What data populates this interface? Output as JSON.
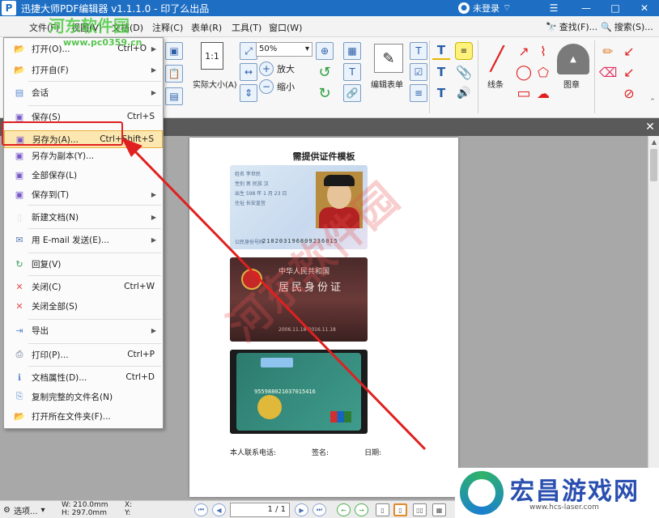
{
  "window": {
    "title": "迅捷大师PDF编辑器 v1.1.1.0 - 印了么出品",
    "user_label": "未登录",
    "app_logo_letter": "P"
  },
  "watermark_site": {
    "name": "河东软件园",
    "url": "www.pc0359.cn"
  },
  "menubar": {
    "items": [
      "文件(F)",
      "视图(V)",
      "文档(D)",
      "注释(C)",
      "表单(R)",
      "工具(T)",
      "窗口(W)"
    ],
    "find_label": "查找(F)...",
    "search_label": "搜索(S)..."
  },
  "toolbar": {
    "zoom_value": "50%",
    "actual_size_label": "实际大小(A)",
    "zoom_in_label": "放大",
    "zoom_out_label": "缩小",
    "edit_form_label": "编辑表单",
    "line_label": "线条",
    "stamp_label": "图章"
  },
  "file_menu": {
    "items": [
      {
        "label": "打开(O)...",
        "shortcut": "Ctrl+O",
        "icon": "folder-open-icon",
        "submenu": true
      },
      {
        "label": "打开自(F)",
        "shortcut": "",
        "icon": "folder-from-icon",
        "submenu": true
      },
      {
        "label": "会话",
        "shortcut": "",
        "icon": "session-icon",
        "submenu": true
      },
      {
        "label": "保存(S)",
        "shortcut": "Ctrl+S",
        "icon": "save-icon",
        "submenu": false
      },
      {
        "label": "另存为(A)...",
        "shortcut": "Ctrl+Shift+S",
        "icon": "save-as-icon",
        "submenu": false
      },
      {
        "label": "另存为副本(Y)...",
        "shortcut": "",
        "icon": "save-copy-icon",
        "submenu": false
      },
      {
        "label": "全部保存(L)",
        "shortcut": "",
        "icon": "save-all-icon",
        "submenu": false
      },
      {
        "label": "保存到(T)",
        "shortcut": "",
        "icon": "save-to-icon",
        "submenu": true
      },
      {
        "label": "新建文档(N)",
        "shortcut": "",
        "icon": "new-document-icon",
        "submenu": true
      },
      {
        "label": "用 E-mail 发送(E)...",
        "shortcut": "",
        "icon": "email-icon",
        "submenu": true
      },
      {
        "label": "回复(V)",
        "shortcut": "",
        "icon": "revert-icon",
        "submenu": false
      },
      {
        "label": "关闭(C)",
        "shortcut": "Ctrl+W",
        "icon": "close-document-icon",
        "submenu": false
      },
      {
        "label": "关闭全部(S)",
        "shortcut": "",
        "icon": "close-all-icon",
        "submenu": false
      },
      {
        "label": "导出",
        "shortcut": "",
        "icon": "export-icon",
        "submenu": true
      },
      {
        "label": "打印(P)...",
        "shortcut": "Ctrl+P",
        "icon": "print-icon",
        "submenu": false
      },
      {
        "label": "文档属性(D)...",
        "shortcut": "Ctrl+D",
        "icon": "document-properties-icon",
        "submenu": false
      },
      {
        "label": "复制完整的文件名(N)",
        "shortcut": "",
        "icon": "copy-filename-icon",
        "submenu": false
      },
      {
        "label": "打开所在文件夹(F)...",
        "shortcut": "",
        "icon": "open-folder-icon",
        "submenu": false
      }
    ]
  },
  "document": {
    "title": "需提供证件模板",
    "id_front_fields": [
      "姓名 李世民",
      "性别 男  民族 汉",
      "出生 598 年 1 月 23 日",
      "住址 长安皇宫"
    ],
    "id_front_number_label": "公民身份号码",
    "id_front_number": "210203196809236015",
    "id_back_country": "中华人民共和国",
    "id_back_title": "居民身份证",
    "id_back_validity": "2006.11.18-2016.11.18",
    "bank_card_number": "955988021037015416",
    "footer": [
      "本人联系电话:",
      "签名:",
      "日期:"
    ],
    "watermark": "河东软件园"
  },
  "statusbar": {
    "options_label": "选项...",
    "width_label": "W: 210.0mm",
    "height_label": "H: 297.0mm",
    "x_label": "X:",
    "y_label": "Y:",
    "page_value": "1 / 1"
  },
  "logo": {
    "name": "宏昌游戏网",
    "url": "www.hcs-laser.com"
  },
  "colors": {
    "title_blue": "#1e6fc4",
    "highlight": "#fde7b0",
    "annotation_red": "#e02020"
  }
}
